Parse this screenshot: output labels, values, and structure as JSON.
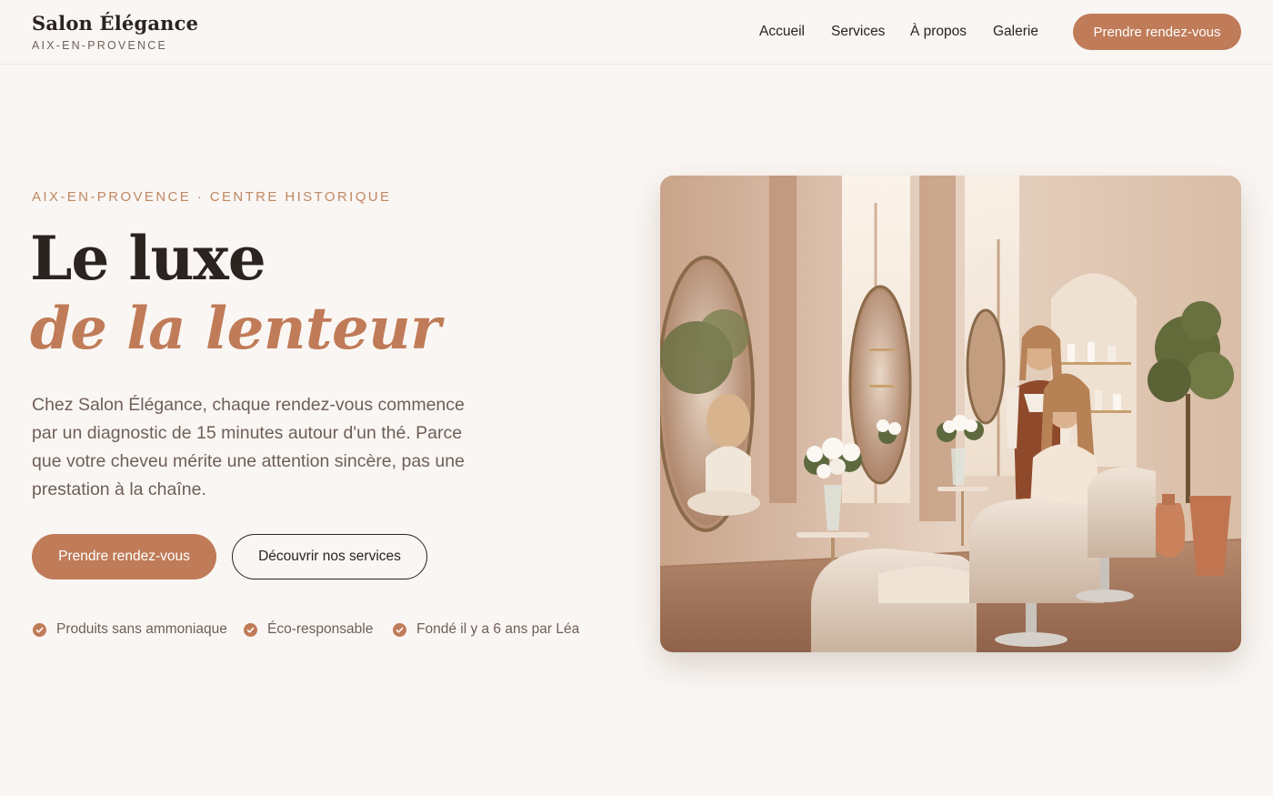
{
  "header": {
    "brand_name": "Salon Élégance",
    "brand_city": "AIX-EN-PROVENCE",
    "nav": [
      "Accueil",
      "Services",
      "À propos",
      "Galerie"
    ],
    "cta_label": "Prendre rendez-vous"
  },
  "hero": {
    "eyebrow": "AIX-EN-PROVENCE · CENTRE HISTORIQUE",
    "headline_line1": "Le luxe",
    "headline_line2": "de la lenteur",
    "lead": "Chez Salon Élégance, chaque rendez-vous commence par un diagnostic de 15 minutes autour d'un thé. Parce que votre cheveu mérite une attention sincère, pas une prestation à la chaîne.",
    "primary_button": "Prendre rendez-vous",
    "secondary_button": "Découvrir nos services",
    "features": [
      "Produits sans ammoniaque",
      "Éco-responsable",
      "Fondé il y a 6 ans par Léa"
    ]
  },
  "colors": {
    "background": "#faf6f3",
    "accent": "#c07b58",
    "text": "#2b2320",
    "muted_text": "#6d5f58"
  }
}
